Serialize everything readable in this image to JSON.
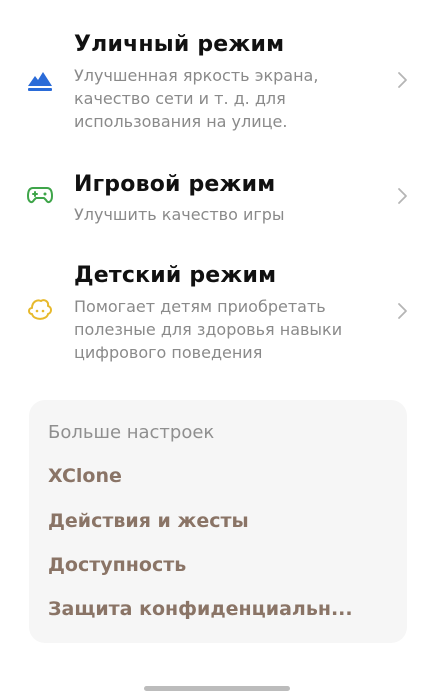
{
  "modes": [
    {
      "title": "Уличный режим",
      "description": "Улучшенная яркость экрана, качество сети и т. д. для использования на улице.",
      "icon": "mountain-icon",
      "icon_color": "#2a6bd8"
    },
    {
      "title": "Игровой режим",
      "description": "Улучшить качество игры",
      "icon": "gamepad-icon",
      "icon_color": "#3fa54a"
    },
    {
      "title": "Детский режим",
      "description": "Помогает детям приобретать полезные для здоровья навыки цифрового поведения",
      "icon": "child-face-icon",
      "icon_color": "#e7b92c"
    }
  ],
  "more_settings": {
    "header": "Больше настроек",
    "links": [
      "XClone",
      "Действия и жесты",
      "Доступность",
      "Защита конфиденциальн..."
    ],
    "link_color": "#8a7466"
  },
  "colors": {
    "chevron": "#b5b5b5",
    "background": "#ffffff",
    "card_background": "#f6f6f6"
  }
}
